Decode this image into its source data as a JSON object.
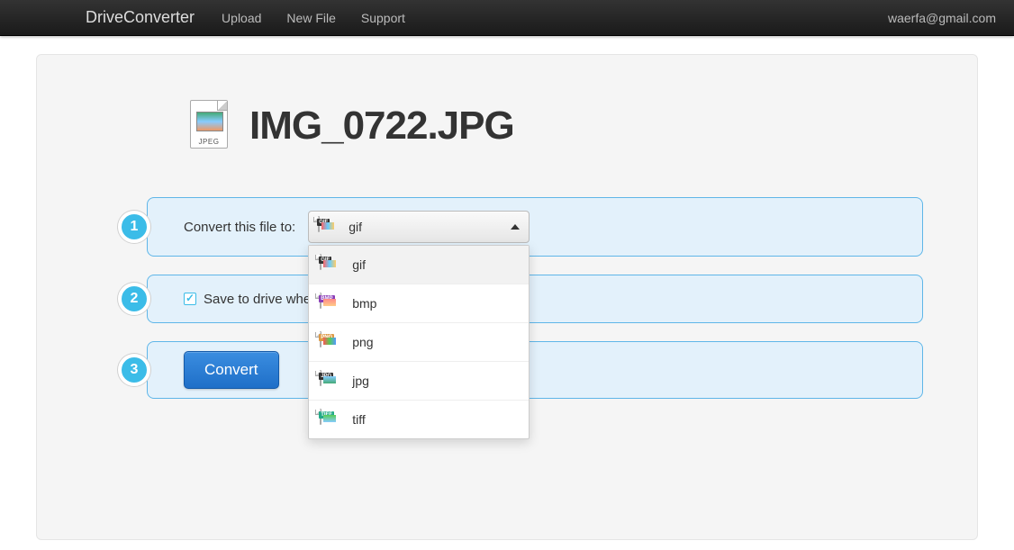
{
  "navbar": {
    "brand": "DriveConverter",
    "links": [
      "Upload",
      "New File",
      "Support"
    ],
    "user_email": "waerfa@gmail.com"
  },
  "file": {
    "name": "IMG_0722.JPG",
    "type_label": "JPEG"
  },
  "steps": {
    "s1": {
      "badge": "1",
      "label": "Convert this file to:",
      "selected_format": "gif",
      "options": [
        {
          "format": "gif",
          "label": "gif"
        },
        {
          "format": "bmp",
          "label": "bmp"
        },
        {
          "format": "png",
          "label": "png"
        },
        {
          "format": "jpg",
          "label": "jpg"
        },
        {
          "format": "tiff",
          "label": "tiff"
        }
      ]
    },
    "s2": {
      "badge": "2",
      "label": "Save to drive when done",
      "checked": true
    },
    "s3": {
      "badge": "3",
      "button_label": "Convert"
    }
  }
}
